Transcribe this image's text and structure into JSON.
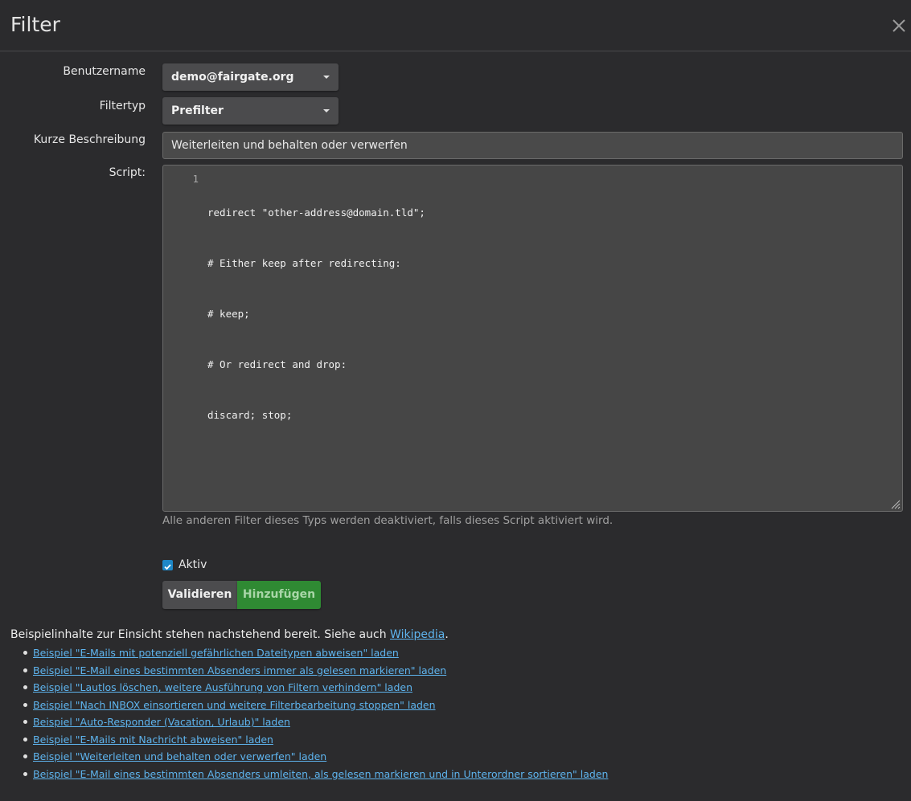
{
  "dialog": {
    "title": "Filter"
  },
  "form": {
    "username_label": "Benutzername",
    "username_value": "demo@fairgate.org",
    "filtertype_label": "Filtertyp",
    "filtertype_value": "Prefilter",
    "description_label": "Kurze Beschreibung",
    "description_value": "Weiterleiten und behalten oder verwerfen",
    "script_label": "Script:",
    "script_lines": [
      "redirect \"other-address@domain.tld\";",
      "# Either keep after redirecting:",
      "# keep;",
      "# Or redirect and drop:",
      "discard; stop;"
    ],
    "line_number": "1",
    "help_text": "Alle anderen Filter dieses Typs werden deaktiviert, falls dieses Script aktiviert wird.",
    "active_label": "Aktiv",
    "active_checked": true,
    "validate_label": "Validieren",
    "add_label": "Hinzufügen"
  },
  "examples": {
    "intro_text": "Beispielinhalte zur Einsicht stehen nachstehend bereit. Siehe auch ",
    "wiki_link": "Wikipedia",
    "intro_end": ".",
    "items": [
      "Beispiel \"E-Mails mit potenziell gefährlichen Dateitypen abweisen\" laden",
      "Beispiel \"E-Mail eines bestimmten Absenders immer als gelesen markieren\" laden",
      "Beispiel \"Lautlos löschen, weitere Ausführung von Filtern verhindern\" laden",
      "Beispiel \"Nach INBOX einsortieren und weitere Filterbearbeitung stoppen\" laden",
      "Beispiel \"Auto-Responder (Vacation, Urlaub)\" laden",
      "Beispiel \"E-Mails mit Nachricht abweisen\" laden",
      "Beispiel \"Weiterleiten und behalten oder verwerfen\" laden",
      "Beispiel \"E-Mail eines bestimmten Absenders umleiten, als gelesen markieren und in Unterordner sortieren\" laden"
    ]
  },
  "colors": {
    "background": "#2b2b2d",
    "accent_green": "#2f8a33",
    "link": "#5eb4ee",
    "checkbox": "#1e88c8"
  },
  "icons": {
    "close": "close-icon",
    "caret": "chevron-down-icon",
    "check": "check-icon",
    "resize": "resize-grip-icon"
  }
}
